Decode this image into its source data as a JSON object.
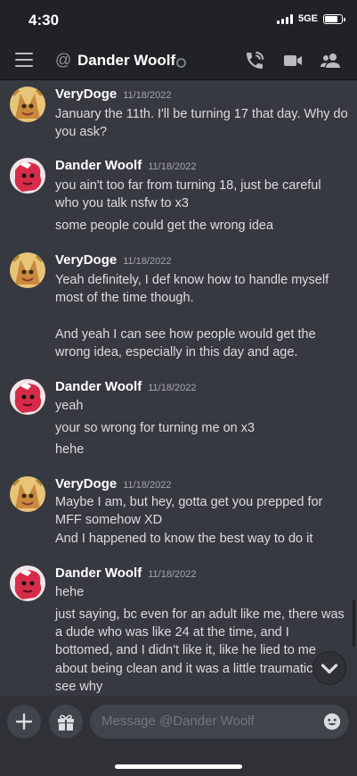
{
  "status_bar": {
    "time": "4:30",
    "network": "5GE",
    "battery_level": 0.7
  },
  "header": {
    "at_symbol": "@",
    "channel": "Dander Woolf",
    "icons": [
      "hamburger-icon",
      "call-icon",
      "video-icon",
      "members-icon"
    ]
  },
  "messages": [
    {
      "author": "VeryDoge",
      "timestamp": "11/18/2022",
      "avatar": "verydoge-avatar",
      "lines": [
        "January the 11th. I'll be turning 17 that day. Why do",
        "you ask?"
      ]
    },
    {
      "author": "Dander Woolf",
      "timestamp": "11/18/2022",
      "avatar": "dander-avatar",
      "lines": [
        "you ain't too far from turning 18, just be careful",
        "who you talk nsfw to x3",
        "some people could get the wrong idea"
      ]
    },
    {
      "author": "VeryDoge",
      "timestamp": "11/18/2022",
      "avatar": "verydoge-avatar",
      "lines": [
        "Yeah definitely, I def know how to handle myself",
        "most of the time though.",
        "And yeah I can see how people would get the",
        "wrong idea, especially in this day and age."
      ]
    },
    {
      "author": "Dander Woolf",
      "timestamp": "11/18/2022",
      "avatar": "dander-avatar",
      "lines": [
        "yeah",
        "your so wrong for turning me on x3",
        "hehe"
      ]
    },
    {
      "author": "VeryDoge",
      "timestamp": "11/18/2022",
      "avatar": "verydoge-avatar",
      "lines": [
        "Maybe I am, but hey, gotta get you prepped for",
        "MFF somehow XD",
        "And I happened to know the best way to do it"
      ]
    },
    {
      "author": "Dander Woolf",
      "timestamp": "11/18/2022",
      "avatar": "dander-avatar",
      "lines": [
        "hehe",
        "just saying, bc even for an adult like me, there was",
        "a dude who was like 24 at the time, and I",
        "bottomed, and I didn't like it, like he lied to me",
        "about being clean and it was a little traumatic",
        "see why"
      ]
    }
  ],
  "composer": {
    "placeholder": "Message @Dander Woolf"
  },
  "colors": {
    "background": "#36393f",
    "header": "#202225",
    "composer": "#2f3136",
    "input": "#40444b"
  }
}
